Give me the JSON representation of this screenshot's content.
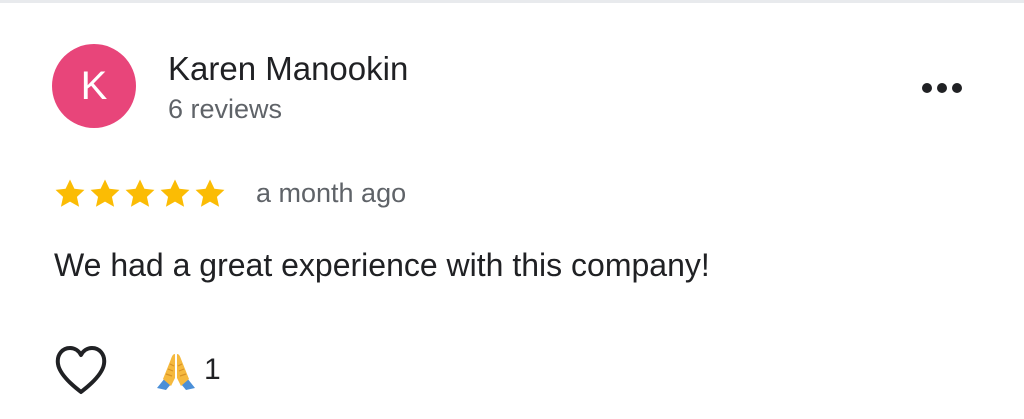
{
  "review": {
    "reviewer": {
      "initial": "K",
      "name": "Karen Manookin",
      "review_count": "6 reviews",
      "avatar_color": "#e8457a"
    },
    "rating": {
      "stars": 5,
      "max_stars": 5,
      "star_color": "#fbbc04"
    },
    "date": "a month ago",
    "text": "We had a great experience with this company!",
    "reactions": {
      "like_icon": "heart-outline-icon",
      "emoji_icon": "folded-hands-emoji-icon",
      "emoji_count": "1"
    },
    "menu_icon": "more-options-icon"
  }
}
